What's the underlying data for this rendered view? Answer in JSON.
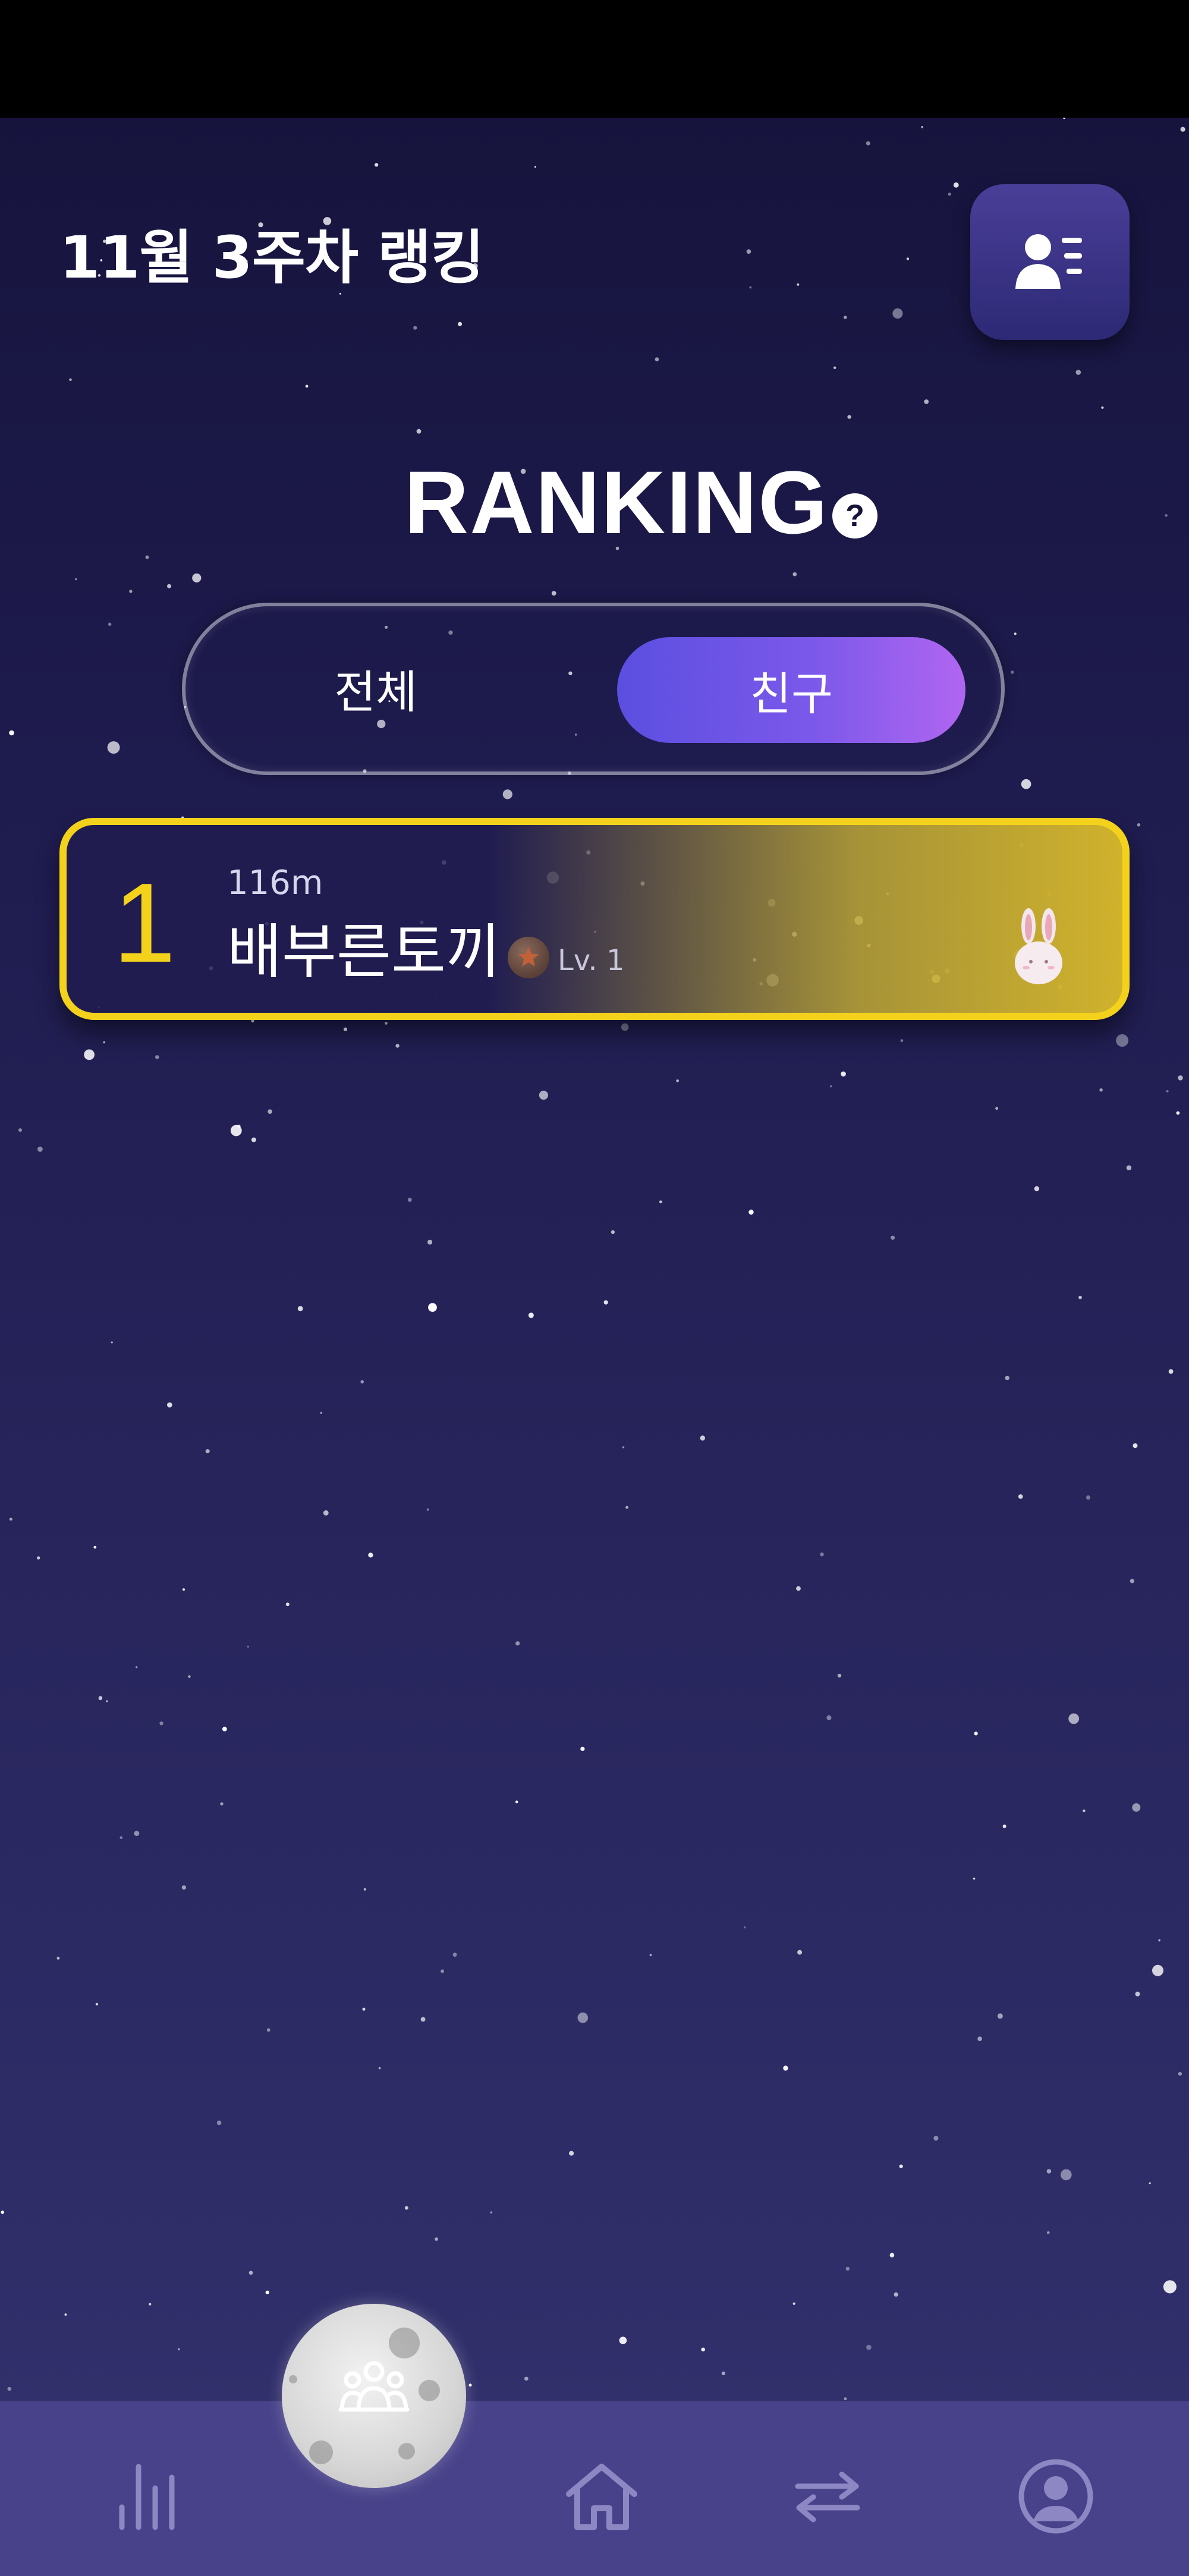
{
  "header": {
    "week_title": "11월 3주차 랭킹",
    "profile_list_icon": "user-list-icon"
  },
  "ranking": {
    "title": "RANKING",
    "help_icon_glyph": "?"
  },
  "scope_toggle": {
    "all_label": "전체",
    "friends_label": "친구",
    "selected": "friends"
  },
  "rank_list": [
    {
      "rank": "1",
      "distance": "116m",
      "name": "배부른토끼",
      "level": "Lv. 1",
      "avatar_icon": "bunny-avatar-icon"
    }
  ],
  "bottom_nav": {
    "items": [
      {
        "icon": "bar-chart-icon"
      },
      {
        "icon": "group-moon-icon",
        "active": true
      },
      {
        "icon": "home-icon"
      },
      {
        "icon": "swap-arrows-icon"
      },
      {
        "icon": "profile-circle-icon"
      }
    ]
  },
  "colors": {
    "background_top": "#15133a",
    "background_bottom": "#34326f",
    "accent_gold": "#f4d21c",
    "toggle_gradient_start": "#5b4fe0",
    "toggle_gradient_end": "#b066f0",
    "nav_bar": "#48428a"
  }
}
